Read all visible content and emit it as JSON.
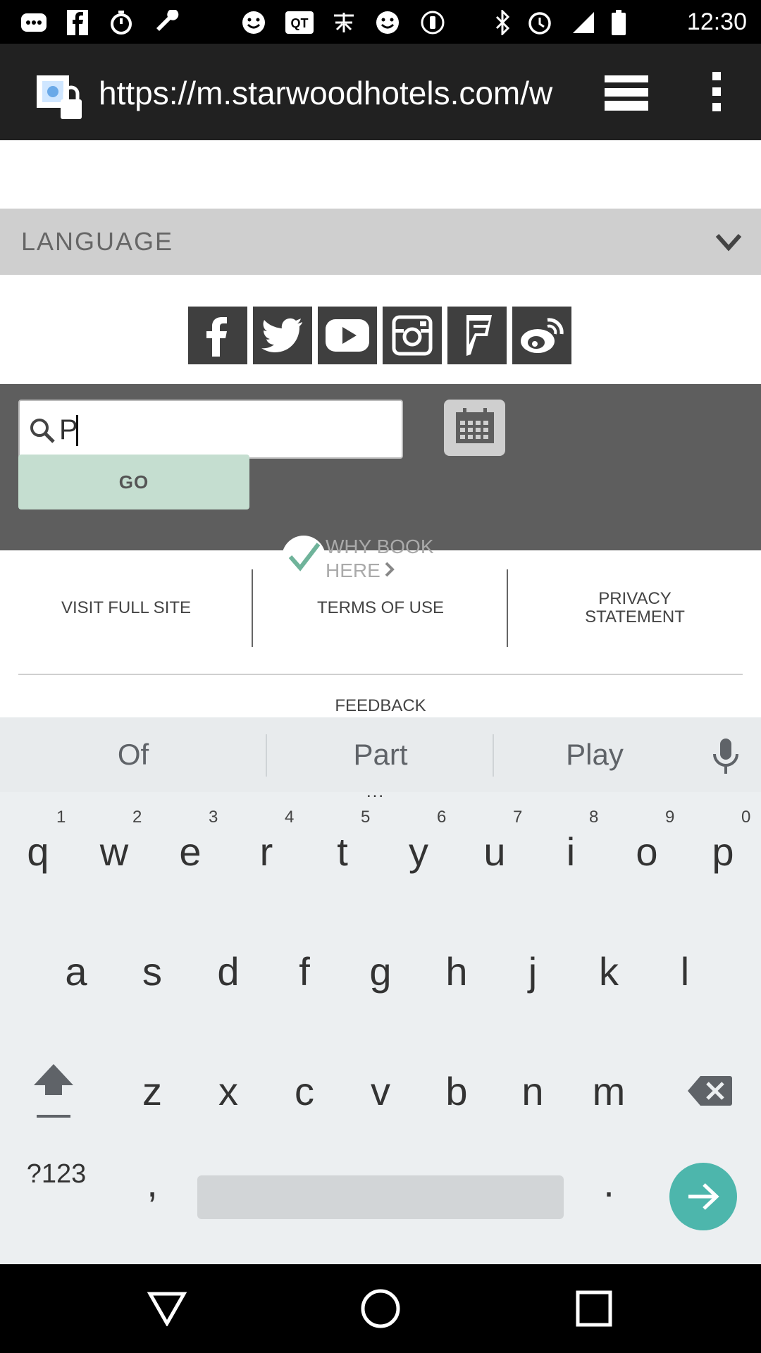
{
  "status_bar": {
    "time": "12:30",
    "icons": [
      "messages-icon",
      "facebook-icon",
      "timer-icon",
      "wrench-icon",
      "emoji-icon",
      "qt-icon",
      "chinese-app-icon",
      "emoji-icon",
      "info-icon",
      "bluetooth-icon",
      "alarm-icon",
      "signal-icon",
      "battery-icon"
    ]
  },
  "browser": {
    "url": "https://m.starwoodhotels.com/w",
    "icons": [
      "lock-icon",
      "tabs-icon",
      "overflow-menu-icon"
    ]
  },
  "page": {
    "language_label": "LANGUAGE",
    "social_icons": [
      "facebook-icon",
      "twitter-icon",
      "youtube-icon",
      "instagram-icon",
      "foursquare-icon",
      "weibo-icon"
    ],
    "search_value": "P",
    "go_label": "GO",
    "why_book_line1": "WHY BOOK",
    "why_book_line2": "HERE",
    "footer": {
      "visit_full_site": "VISIT FULL SITE",
      "terms_of_use": "TERMS OF USE",
      "privacy_line1": "PRIVACY",
      "privacy_line2": "STATEMENT",
      "feedback": "FEEDBACK"
    }
  },
  "keyboard": {
    "suggestions": [
      "Of",
      "Part",
      "Play"
    ],
    "more_indicator": "...",
    "row1": [
      "q",
      "w",
      "e",
      "r",
      "t",
      "y",
      "u",
      "i",
      "o",
      "p"
    ],
    "row1_hints": [
      "1",
      "2",
      "3",
      "4",
      "5",
      "6",
      "7",
      "8",
      "9",
      "0"
    ],
    "row2": [
      "a",
      "s",
      "d",
      "f",
      "g",
      "h",
      "j",
      "k",
      "l"
    ],
    "row3": [
      "z",
      "x",
      "c",
      "v",
      "b",
      "n",
      "m"
    ],
    "symbols_label": "?123",
    "comma": ",",
    "period": ".",
    "accent_color": "#4db6ac"
  },
  "nav_bar": {
    "icons": [
      "back-icon",
      "home-icon",
      "recents-icon"
    ]
  }
}
